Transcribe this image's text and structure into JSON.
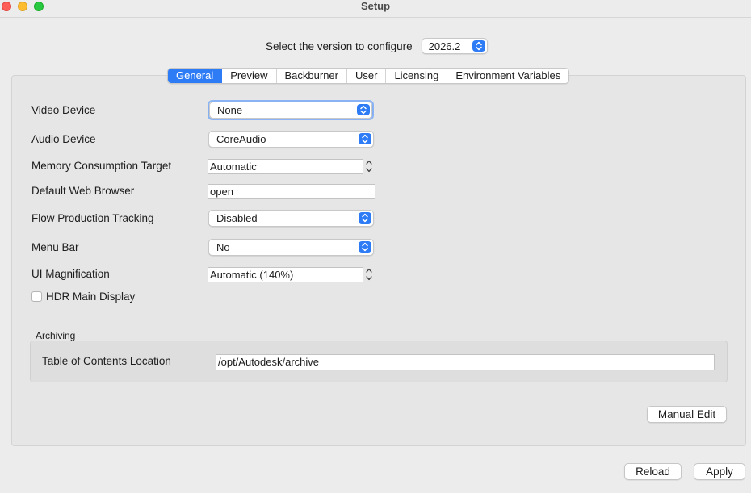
{
  "window": {
    "title": "Setup"
  },
  "version": {
    "label": "Select the version to configure",
    "value": "2026.2"
  },
  "tabs": [
    "General",
    "Preview",
    "Backburner",
    "User",
    "Licensing",
    "Environment Variables"
  ],
  "general": {
    "video_device": {
      "label": "Video Device",
      "value": "None"
    },
    "audio_device": {
      "label": "Audio Device",
      "value": "CoreAudio"
    },
    "memory_target": {
      "label": "Memory Consumption Target",
      "value": "Automatic"
    },
    "web_browser": {
      "label": "Default Web Browser",
      "value": "open"
    },
    "flow_tracking": {
      "label": "Flow Production Tracking",
      "value": "Disabled"
    },
    "menu_bar": {
      "label": "Menu Bar",
      "value": "No"
    },
    "ui_magnification": {
      "label": "UI Magnification",
      "value": "Automatic (140%)"
    },
    "hdr_main_display": {
      "label": "HDR Main Display",
      "checked": false
    }
  },
  "archiving": {
    "title": "Archiving",
    "toc_location": {
      "label": "Table of Contents Location",
      "value": "/opt/Autodesk/archive"
    }
  },
  "buttons": {
    "manual_edit": "Manual Edit",
    "reload": "Reload",
    "apply": "Apply"
  },
  "colors": {
    "accent": "#2d7cf6",
    "background": "#ececec",
    "panel": "#e6e6e6"
  }
}
